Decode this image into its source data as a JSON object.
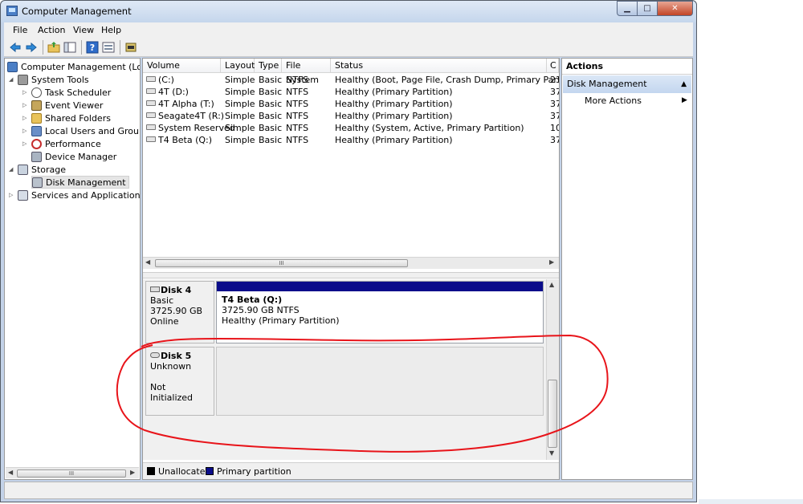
{
  "window": {
    "title": "Computer Management"
  },
  "menu": [
    "File",
    "Action",
    "View",
    "Help"
  ],
  "toolbar": {
    "icons": [
      "back-arrow-icon",
      "forward-arrow-icon",
      "up-folder-icon",
      "show-hide-tree-icon",
      "help-icon",
      "properties-icon",
      "disk-settings-icon"
    ]
  },
  "tree": {
    "items": [
      {
        "label": "Computer Management (Local)",
        "expander": "",
        "icon": "computer-management-icon"
      },
      {
        "label": "System Tools",
        "expander": "◢",
        "icon": "system-tools-icon"
      },
      {
        "label": "Task Scheduler",
        "expander": "▷",
        "icon": "clock-icon"
      },
      {
        "label": "Event Viewer",
        "expander": "▷",
        "icon": "event-viewer-icon"
      },
      {
        "label": "Shared Folders",
        "expander": "▷",
        "icon": "shared-folder-icon"
      },
      {
        "label": "Local Users and Groups",
        "expander": "▷",
        "icon": "users-icon"
      },
      {
        "label": "Performance",
        "expander": "▷",
        "icon": "performance-icon"
      },
      {
        "label": "Device Manager",
        "expander": "",
        "icon": "device-manager-icon"
      },
      {
        "label": "Storage",
        "expander": "◢",
        "icon": "storage-icon"
      },
      {
        "label": "Disk Management",
        "expander": "",
        "icon": "disk-management-icon"
      },
      {
        "label": "Services and Applications",
        "expander": "▷",
        "icon": "services-icon"
      }
    ],
    "scrollbar_grip": "III"
  },
  "volumes": {
    "columns": [
      "Volume",
      "Layout",
      "Type",
      "File System",
      "Status",
      "C"
    ],
    "rows": [
      [
        "(C:)",
        "Simple",
        "Basic",
        "NTFS",
        "Healthy (Boot, Page File, Crash Dump, Primary Partition)",
        "23"
      ],
      [
        "4T (D:)",
        "Simple",
        "Basic",
        "NTFS",
        "Healthy (Primary Partition)",
        "37"
      ],
      [
        "4T Alpha (T:)",
        "Simple",
        "Basic",
        "NTFS",
        "Healthy (Primary Partition)",
        "37"
      ],
      [
        "Seagate4T (R:)",
        "Simple",
        "Basic",
        "NTFS",
        "Healthy (Primary Partition)",
        "37"
      ],
      [
        "System Reserved",
        "Simple",
        "Basic",
        "NTFS",
        "Healthy (System, Active, Primary Partition)",
        "10"
      ],
      [
        "T4 Beta (Q:)",
        "Simple",
        "Basic",
        "NTFS",
        "Healthy (Primary Partition)",
        "37"
      ]
    ],
    "scrollbar_grip": "III"
  },
  "disks": [
    {
      "name": "Disk 4",
      "type": "Basic",
      "size": "3725.90 GB",
      "state": "Online",
      "partition": {
        "name": "T4 Beta  (Q:)",
        "size_fs": "3725.90 GB NTFS",
        "status": "Healthy (Primary Partition)"
      }
    },
    {
      "name": "Disk 5",
      "type": "Unknown",
      "state": "Not Initialized"
    }
  ],
  "legend": {
    "unallocated": "Unallocated",
    "primary": "Primary partition"
  },
  "actions": {
    "title": "Actions",
    "section": "Disk Management",
    "item": "More Actions"
  },
  "colors": {
    "primary_partition": "#0a0c8a",
    "annotation": "#e8141a",
    "section_bg": "#c3d6ef"
  }
}
